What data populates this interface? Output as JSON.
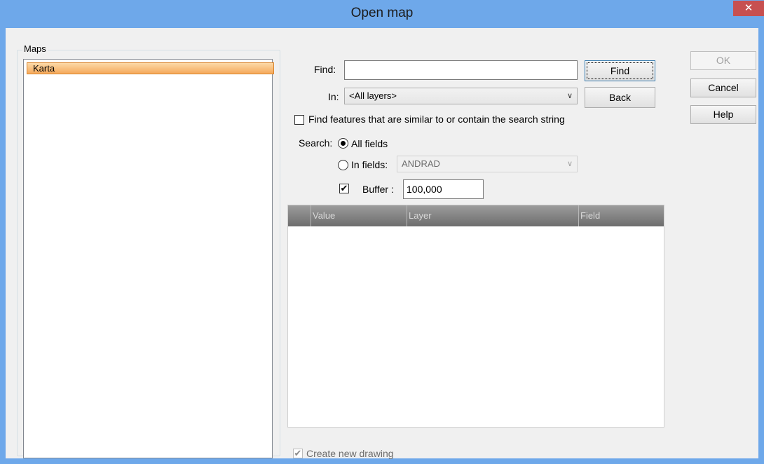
{
  "window": {
    "title": "Open map",
    "close_glyph": "✕"
  },
  "maps": {
    "legend": "Maps",
    "items": [
      {
        "label": "Karta"
      }
    ]
  },
  "find": {
    "label": "Find:",
    "value": "",
    "in_label": "In:",
    "in_selected": "<All layers>",
    "find_button": "Find",
    "back_button": "Back"
  },
  "similar": {
    "label": "Find features that are similar to or contain the search string",
    "checked": false
  },
  "search": {
    "label": "Search:",
    "all_fields_label": "All fields",
    "in_fields_label": "In fields:",
    "field_selected": "ANDRAD",
    "mode": "all_fields"
  },
  "buffer": {
    "label": "Buffer :",
    "value": "100,000",
    "checked": true
  },
  "results": {
    "columns": [
      "Value",
      "Layer",
      "Field"
    ],
    "rows": []
  },
  "create_drawing": {
    "label": "Create new drawing",
    "checked": true
  },
  "buttons": {
    "ok": "OK",
    "cancel": "Cancel",
    "help": "Help"
  },
  "icons": {
    "close": "close-icon",
    "dropdown": "chevron-down-icon",
    "check": "check-icon"
  },
  "colors": {
    "titlebar": "#6ea8ea",
    "close": "#c75050",
    "selection": "#f5a95b",
    "grid_header": "#7d7d7d"
  }
}
